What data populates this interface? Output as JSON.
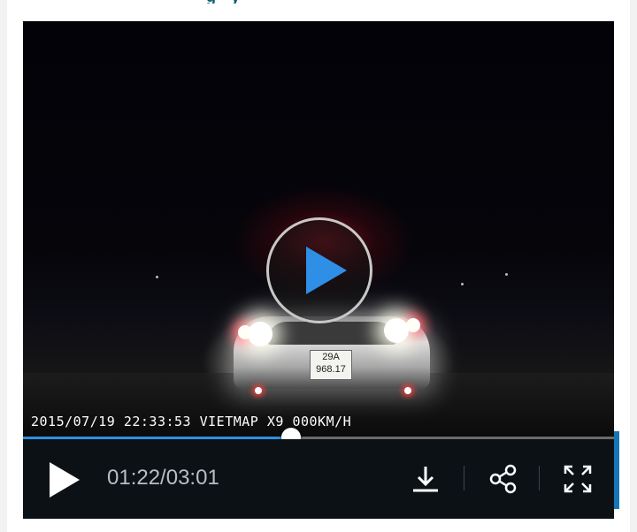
{
  "header": {
    "title_fragment": "g  y"
  },
  "video": {
    "overlay_text": "2015/07/19 22:33:53 VIETMAP X9 000KM/H",
    "plate_line1": "29A",
    "plate_line2": "968.17"
  },
  "player": {
    "current_time": "01:22",
    "duration": "03:01",
    "time_display": "01:22/03:01",
    "progress_fraction": 0.453,
    "accent_color": "#2f8ee6"
  },
  "icons": {
    "big_play": "play-icon",
    "play": "play-icon",
    "download": "download-icon",
    "share": "share-icon",
    "fullscreen": "fullscreen-icon"
  }
}
